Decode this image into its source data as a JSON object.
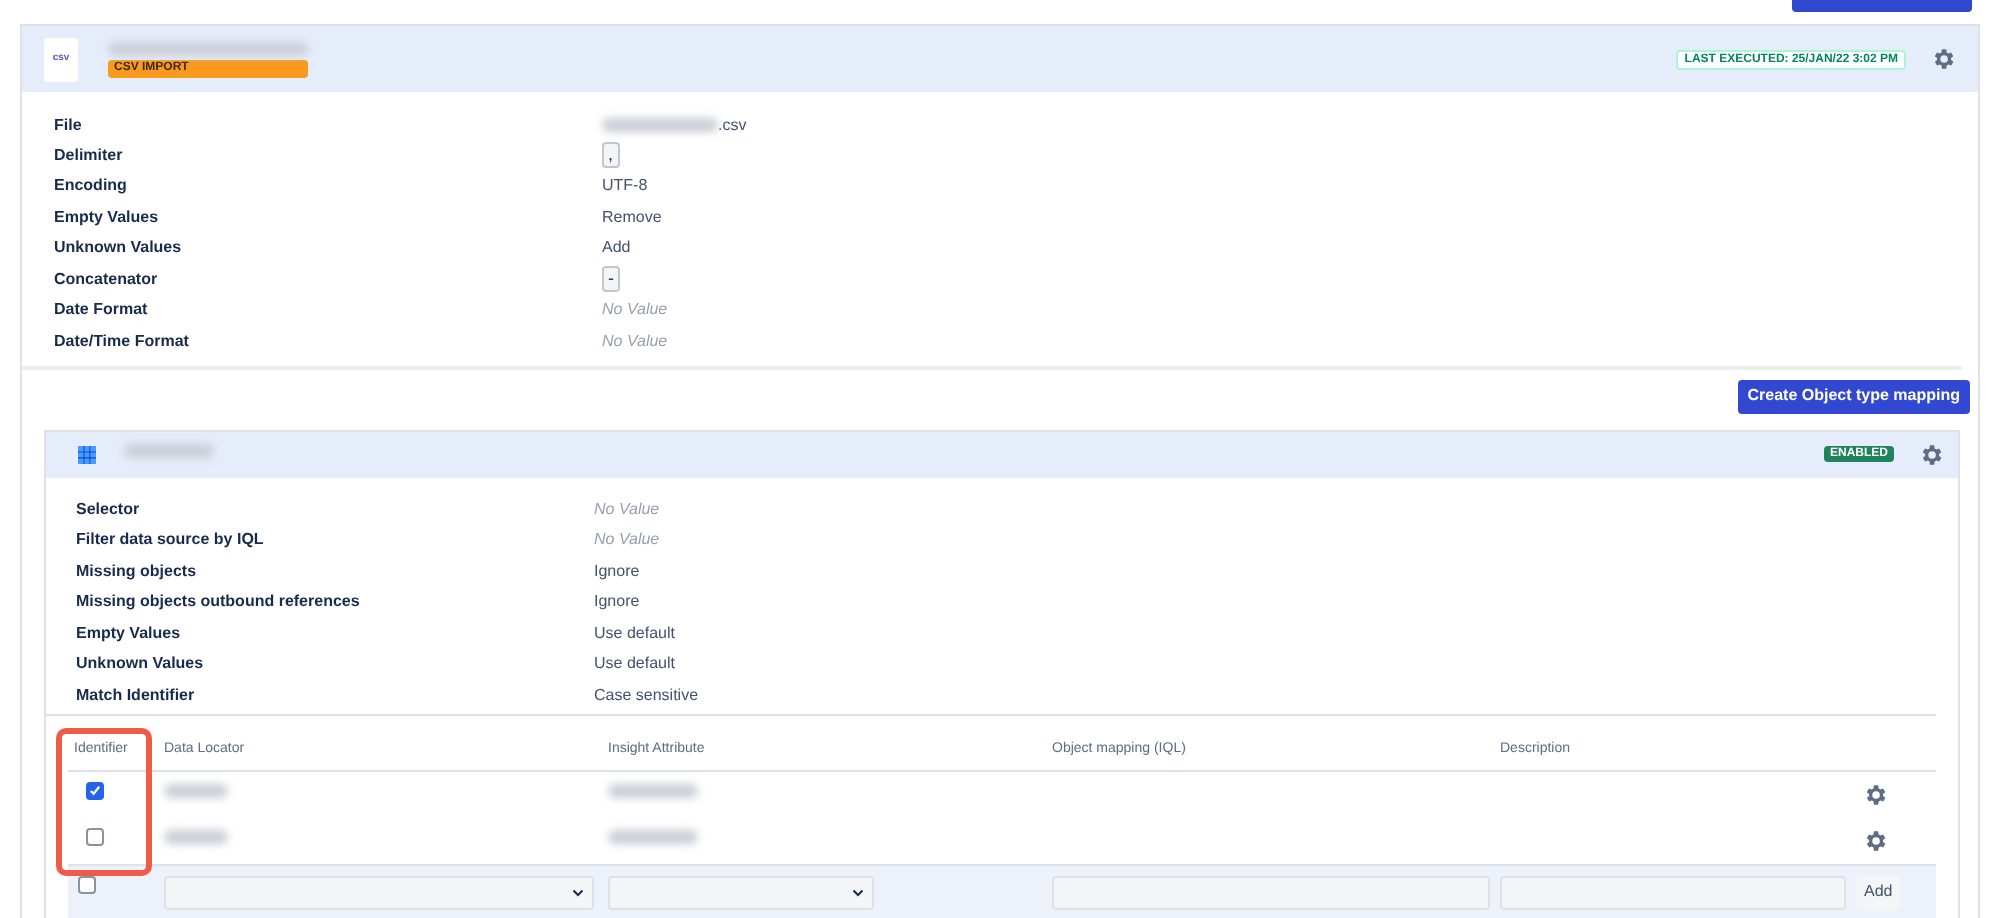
{
  "header": {
    "file_icon": "csv",
    "badge": "CSV IMPORT",
    "status": "LAST EXECUTED: 25/JAN/22 3:02 PM"
  },
  "details": [
    {
      "label": "File",
      "value": ".csv",
      "kind": "file"
    },
    {
      "label": "Delimiter",
      "value": ",",
      "kind": "code"
    },
    {
      "label": "Encoding",
      "value": "UTF-8",
      "kind": "text"
    },
    {
      "label": "Empty Values",
      "value": "Remove",
      "kind": "text"
    },
    {
      "label": "Unknown Values",
      "value": "Add",
      "kind": "text"
    },
    {
      "label": "Concatenator",
      "value": "-",
      "kind": "code"
    },
    {
      "label": "Date Format",
      "value": "No Value",
      "kind": "empty"
    },
    {
      "label": "Date/Time Format",
      "value": "No Value",
      "kind": "empty"
    }
  ],
  "create_button": "Create Object type mapping",
  "mapping": {
    "status": "ENABLED",
    "details": [
      {
        "label": "Selector",
        "value": "No Value",
        "kind": "empty"
      },
      {
        "label": "Filter data source by IQL",
        "value": "No Value",
        "kind": "empty"
      },
      {
        "label": "Missing objects",
        "value": "Ignore",
        "kind": "text"
      },
      {
        "label": "Missing objects outbound references",
        "value": "Ignore",
        "kind": "text"
      },
      {
        "label": "Empty Values",
        "value": "Use default",
        "kind": "text"
      },
      {
        "label": "Unknown Values",
        "value": "Use default",
        "kind": "text"
      },
      {
        "label": "Match Identifier",
        "value": "Case sensitive",
        "kind": "text"
      }
    ],
    "table": {
      "columns": [
        "Identifier",
        "Data Locator",
        "Insight Attribute",
        "Object mapping (IQL)",
        "Description"
      ],
      "rows": [
        {
          "identifier": true
        },
        {
          "identifier": false
        }
      ],
      "new_row": {
        "identifier": false,
        "add_button": "Add"
      }
    }
  }
}
